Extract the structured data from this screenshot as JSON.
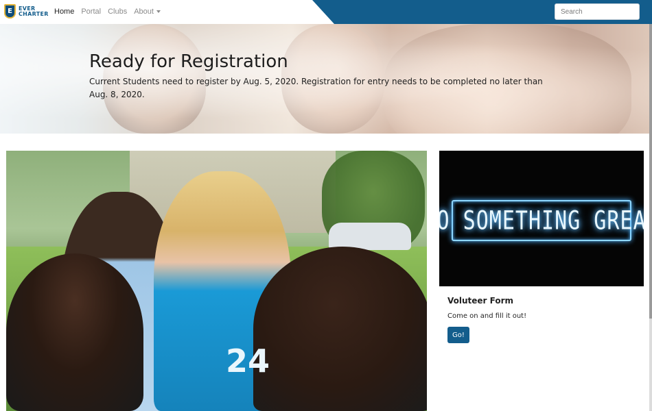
{
  "navbar": {
    "brand": {
      "emblem_letter": "E",
      "line1": "EVER",
      "line2": "CHARTER"
    },
    "links": [
      {
        "label": "Home",
        "active": true
      },
      {
        "label": "Portal",
        "active": false
      },
      {
        "label": "Clubs",
        "active": false
      },
      {
        "label": "About",
        "active": false,
        "dropdown": true
      }
    ],
    "search": {
      "placeholder": "Search",
      "value": ""
    },
    "accent_color": "#135d8c"
  },
  "hero": {
    "title": "Ready for Registration",
    "subtitle": "Current Students need to register by Aug. 5, 2020. Registration for entry needs to be completed no later than Aug. 8, 2020."
  },
  "feature_photo": {
    "shirt_text": "24"
  },
  "card": {
    "image_sign_text": "DO SOMETHING GREAT",
    "title": "Voluteer Form",
    "text": "Come on and fill it out!",
    "button_label": "Go!"
  }
}
